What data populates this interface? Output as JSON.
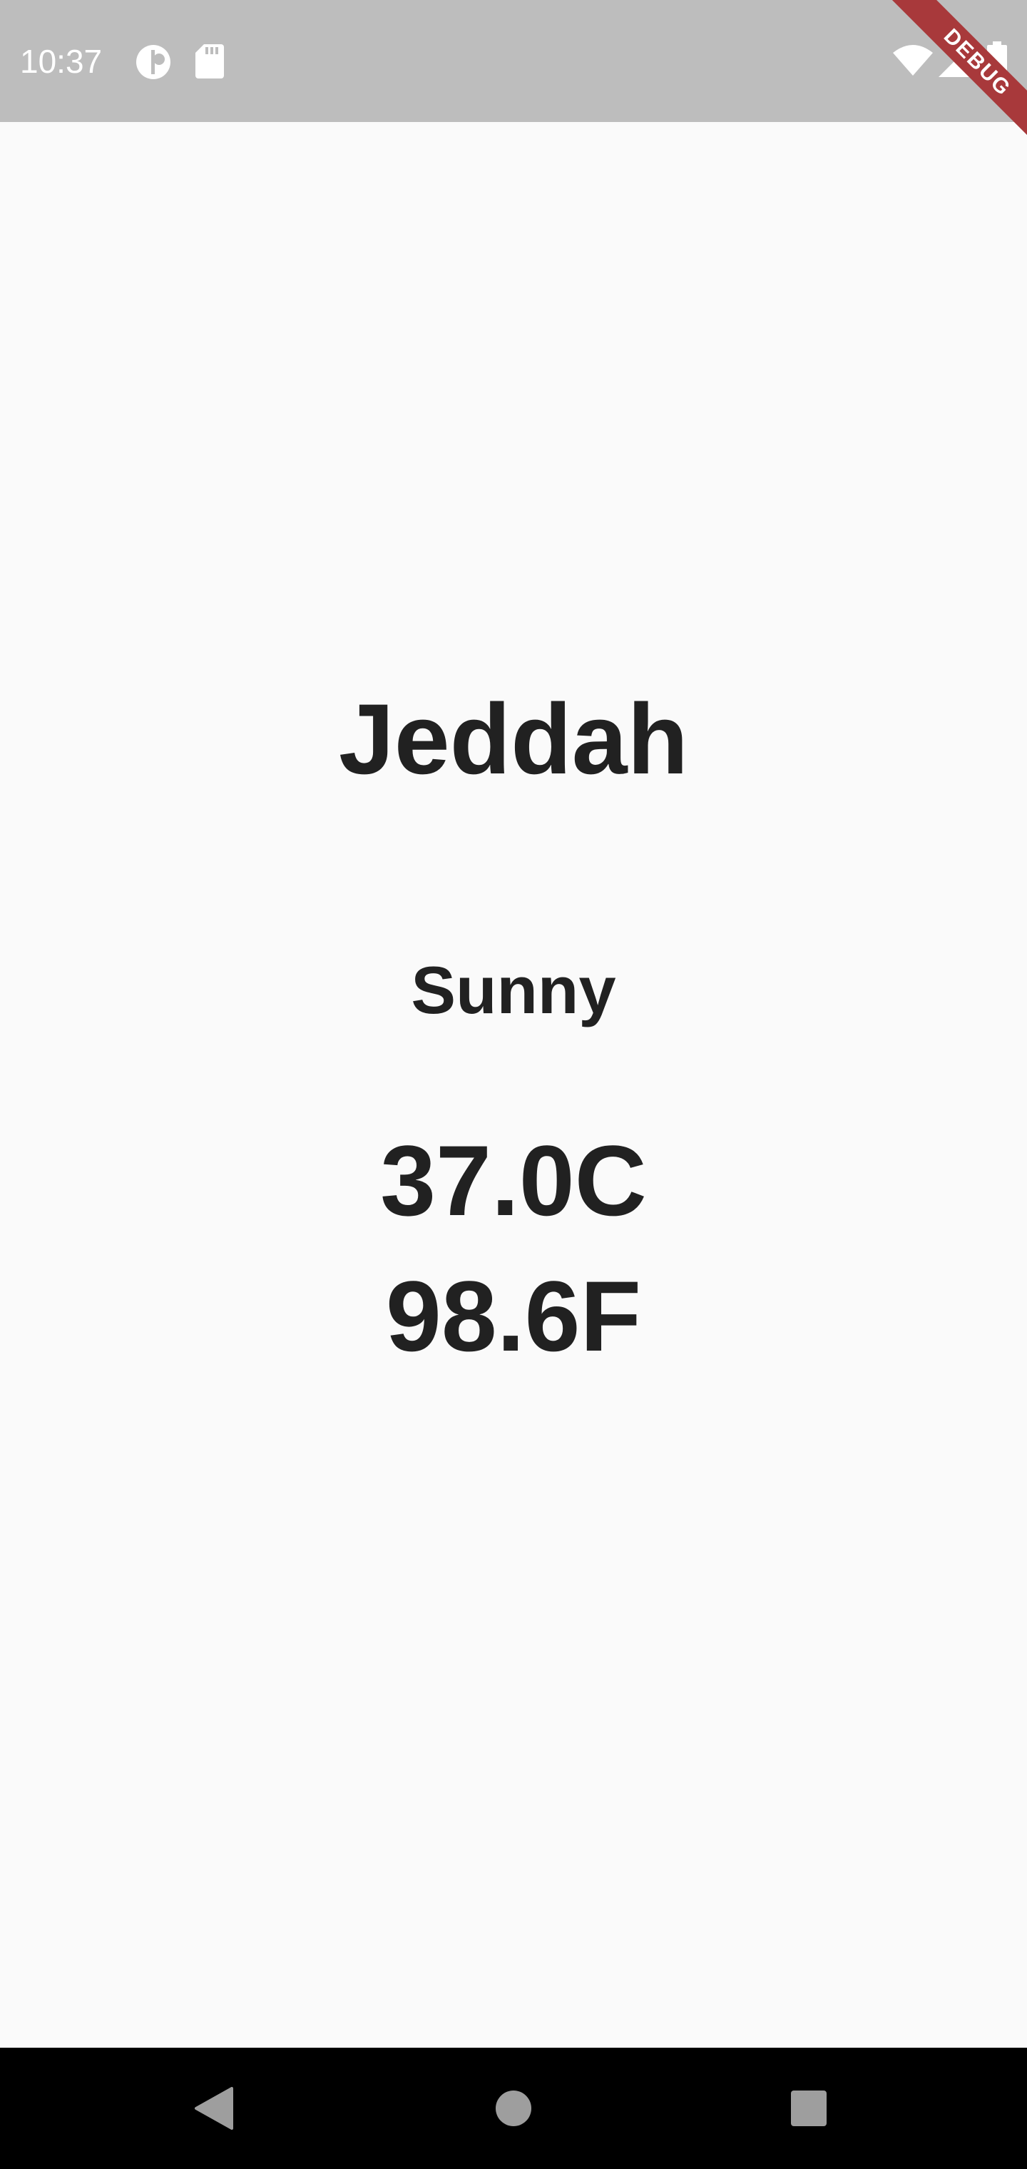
{
  "status_bar": {
    "time": "10:37",
    "left_icons": [
      "notification-icon",
      "sd-card-icon"
    ],
    "right_icons": [
      "wifi-icon",
      "signal-icon",
      "battery-icon"
    ],
    "background": "#bdbdbd"
  },
  "debug_banner": {
    "label": "DEBUG",
    "color": "#a8393b"
  },
  "weather": {
    "city": "Jeddah",
    "condition": "Sunny",
    "temp_c": "37.0C",
    "temp_f": "98.6F"
  },
  "nav_bar": {
    "buttons": [
      "back-icon",
      "home-icon",
      "recents-icon"
    ]
  },
  "colors": {
    "background": "#fafafa",
    "text": "#212121",
    "nav_bar": "#000000",
    "nav_icons": "#9e9e9e"
  }
}
